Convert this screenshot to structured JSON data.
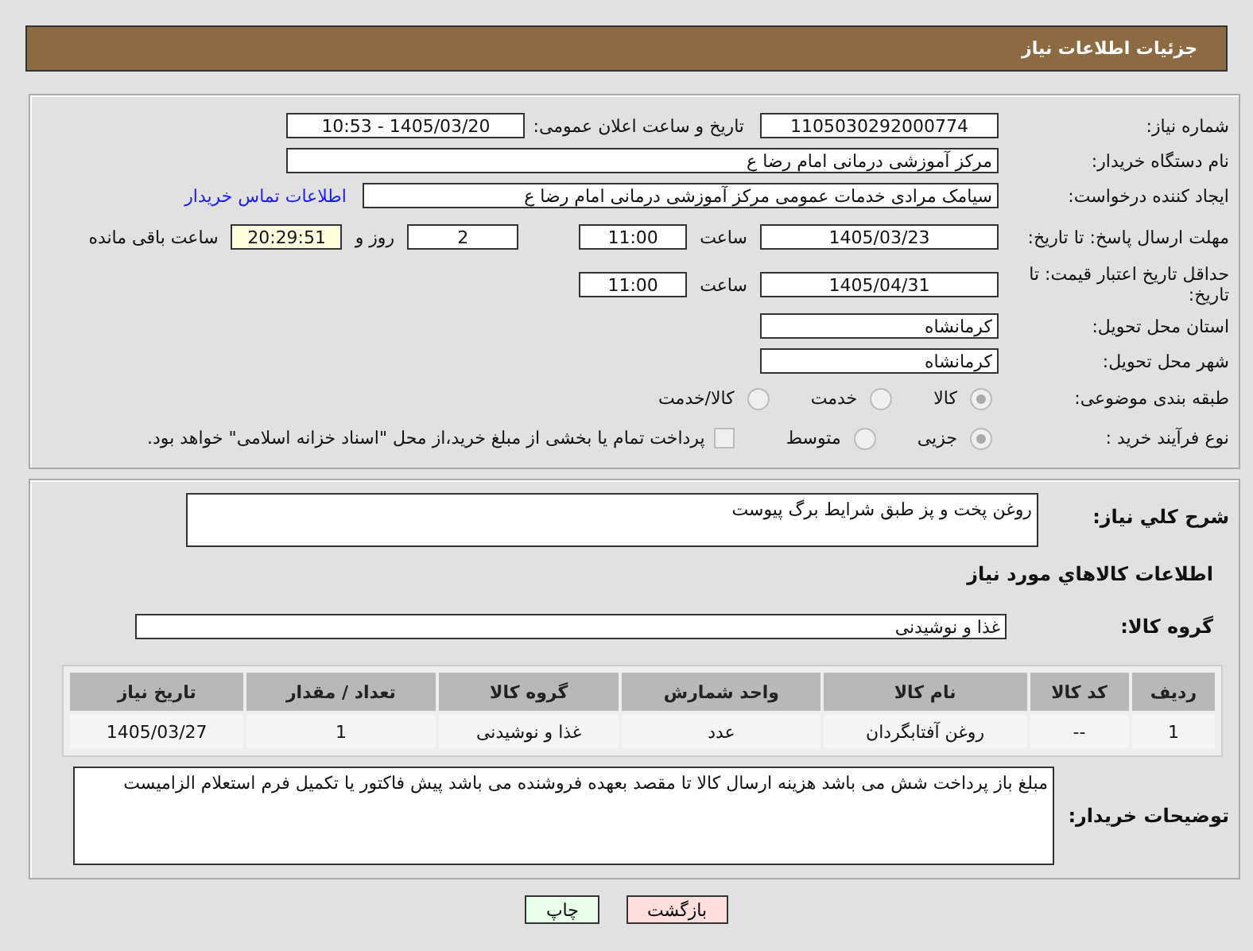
{
  "header": {
    "title": "جزئیات اطلاعات نیاز"
  },
  "need_number": {
    "label": "شماره نیاز:",
    "value": "1105030292000774"
  },
  "announce": {
    "label": "تاریخ و ساعت اعلان عمومی:",
    "value": "1405/03/20 - 10:53"
  },
  "buyer_org": {
    "label": "نام دستگاه خریدار:",
    "value": "مرکز آموزشی  درمانی امام رضا  ع"
  },
  "requester": {
    "label": "ایجاد کننده درخواست:",
    "value": "سیامک مرادی خدمات عمومی مرکز آموزشی  درمانی امام رضا  ع",
    "link": "اطلاعات تماس خریدار"
  },
  "deadline": {
    "label": "مهلت ارسال پاسخ: تا تاریخ:",
    "date": "1405/03/23",
    "time_label": "ساعت",
    "time": "11:00",
    "days": "2",
    "days_label": "روز و",
    "remaining": "20:29:51",
    "remaining_label": "ساعت باقی مانده"
  },
  "validity": {
    "label": "حداقل تاریخ اعتبار قیمت: تا تاریخ:",
    "date": "1405/04/31",
    "time_label": "ساعت",
    "time": "11:00"
  },
  "province": {
    "label": "استان محل تحویل:",
    "value": "کرمانشاه"
  },
  "city": {
    "label": "شهر محل تحویل:",
    "value": "کرمانشاه"
  },
  "category": {
    "label": "طبقه بندی موضوعی:",
    "options": [
      {
        "label": "کالا",
        "selected": true
      },
      {
        "label": "خدمت",
        "selected": false
      },
      {
        "label": "کالا/خدمت",
        "selected": false
      }
    ]
  },
  "process": {
    "label": "نوع فرآیند خرید :",
    "options": [
      {
        "label": "جزیی",
        "selected": true
      },
      {
        "label": "متوسط",
        "selected": false
      }
    ],
    "treasury": {
      "checked": false,
      "label": "پرداخت تمام یا بخشی از مبلغ خرید،از محل \"اسناد خزانه اسلامی\" خواهد بود."
    }
  },
  "description": {
    "label": "شرح کلي نياز:",
    "value": "روغن پخت و پز طبق شرایط برگ پیوست"
  },
  "goods_heading": "اطلاعات کالاهاي مورد نياز",
  "goods_group": {
    "label": "گروه کالا:",
    "value": "غذا و نوشیدنی"
  },
  "table": {
    "columns": [
      "رديف",
      "کد کالا",
      "نام کالا",
      "واحد شمارش",
      "گروه کالا",
      "تعداد / مقدار",
      "تاریخ نیاز"
    ],
    "rows": [
      [
        "1",
        "--",
        "روغن آفتابگردان",
        "عدد",
        "غذا و نوشیدنی",
        "1",
        "1405/03/27"
      ]
    ]
  },
  "buyer_notes": {
    "label": "توضیحات خریدار:",
    "value": "مبلغ باز پرداخت شش می باشد هزینه ارسال کالا تا مقصد بعهده فروشنده می باشد پیش فاکتور یا تکمیل فرم استعلام الزامیست"
  },
  "buttons": [
    {
      "label": "بازگشت",
      "kind": "back"
    },
    {
      "label": "چاپ",
      "kind": "print"
    }
  ]
}
